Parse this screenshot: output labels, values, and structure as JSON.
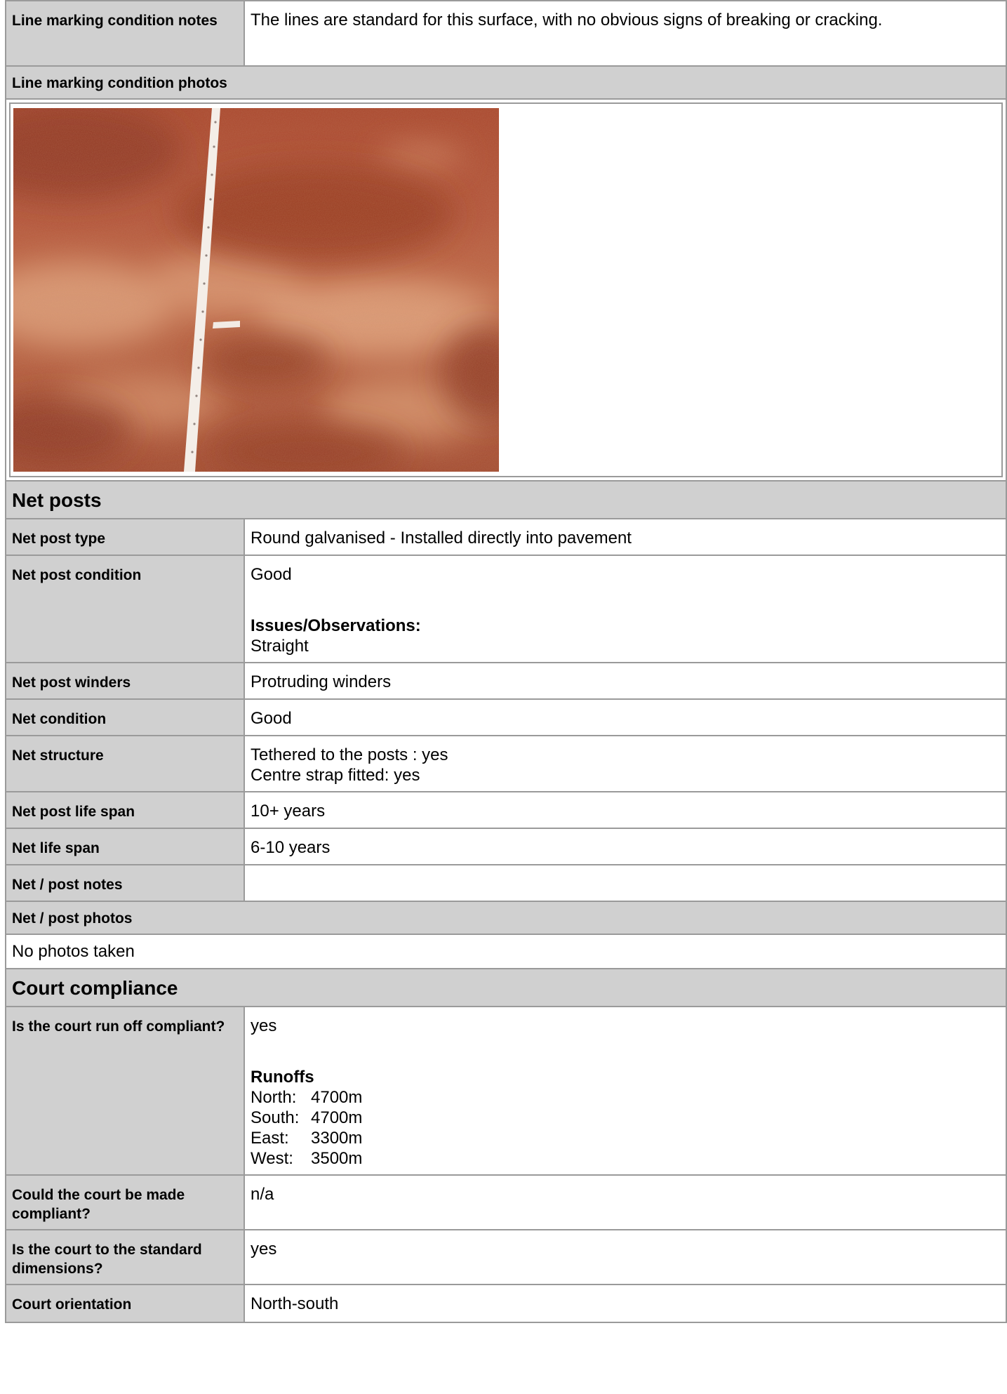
{
  "line_marking": {
    "notes_label": "Line marking condition notes",
    "notes_value": "The lines are standard for this surface, with no obvious signs of breaking or cracking.",
    "photos_label": "Line marking condition photos"
  },
  "net_posts": {
    "section_title": "Net posts",
    "rows": [
      {
        "label": "Net post type",
        "value": "Round galvanised - Installed directly into pavement"
      },
      {
        "label": "Net post condition",
        "value": "Good",
        "issues_title": "Issues/Observations:",
        "issues_value": "Straight"
      },
      {
        "label": "Net post winders",
        "value": "Protruding winders"
      },
      {
        "label": "Net condition",
        "value": "Good"
      },
      {
        "label": "Net structure",
        "value_line1": "Tethered to the posts : yes",
        "value_line2": "Centre strap fitted: yes"
      },
      {
        "label": "Net post life span",
        "value": "10+ years"
      },
      {
        "label": "Net life span",
        "value": "6-10 years"
      },
      {
        "label": "Net / post notes",
        "value": ""
      }
    ],
    "photos_label": "Net / post photos",
    "photos_value": "No photos taken"
  },
  "court_compliance": {
    "section_title": "Court compliance",
    "runoff_label": "Is the court run off compliant?",
    "runoff_value": "yes",
    "runoffs_title": "Runoffs",
    "runoffs": [
      {
        "dir": "North:",
        "value": "4700m"
      },
      {
        "dir": "South:",
        "value": "4700m"
      },
      {
        "dir": "East:",
        "value": "3300m"
      },
      {
        "dir": "West:",
        "value": "3500m"
      }
    ],
    "made_compliant_label": "Could the court be made compliant?",
    "made_compliant_value": "n/a",
    "standard_dims_label": "Is the court to the standard dimensions?",
    "standard_dims_value": "yes",
    "orientation_label": "Court orientation",
    "orientation_value": "North-south"
  },
  "colors": {
    "label_bg": "#d0d0d0",
    "border": "#9a9a9a",
    "clay": "#b5502e"
  }
}
